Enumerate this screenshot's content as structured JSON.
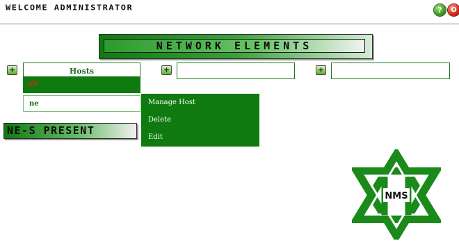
{
  "header": {
    "welcome_text": "WELCOME ADMINISTRATOR",
    "help_label": "?",
    "logout_label": "O"
  },
  "banner": {
    "title": "NETWORK ELEMENTS"
  },
  "columns": [
    {
      "title": "Hosts",
      "expand_label": "+"
    },
    {
      "title": "",
      "expand_label": "+"
    },
    {
      "title": "",
      "expand_label": "+"
    }
  ],
  "host_list": [
    {
      "label": "s9",
      "selected": true
    },
    {
      "label": "ne",
      "selected": false
    }
  ],
  "context_menu": {
    "items": [
      "Manage Host",
      "Delete",
      "Edit"
    ]
  },
  "section": {
    "ne_present_title": "NE-S PRESENT"
  },
  "logo": {
    "text": "NMS"
  },
  "colors": {
    "brand_green": "#0f7a0f",
    "selected_text": "#e02020",
    "help_button": "#2f8f16",
    "logout_button": "#c41a06"
  }
}
